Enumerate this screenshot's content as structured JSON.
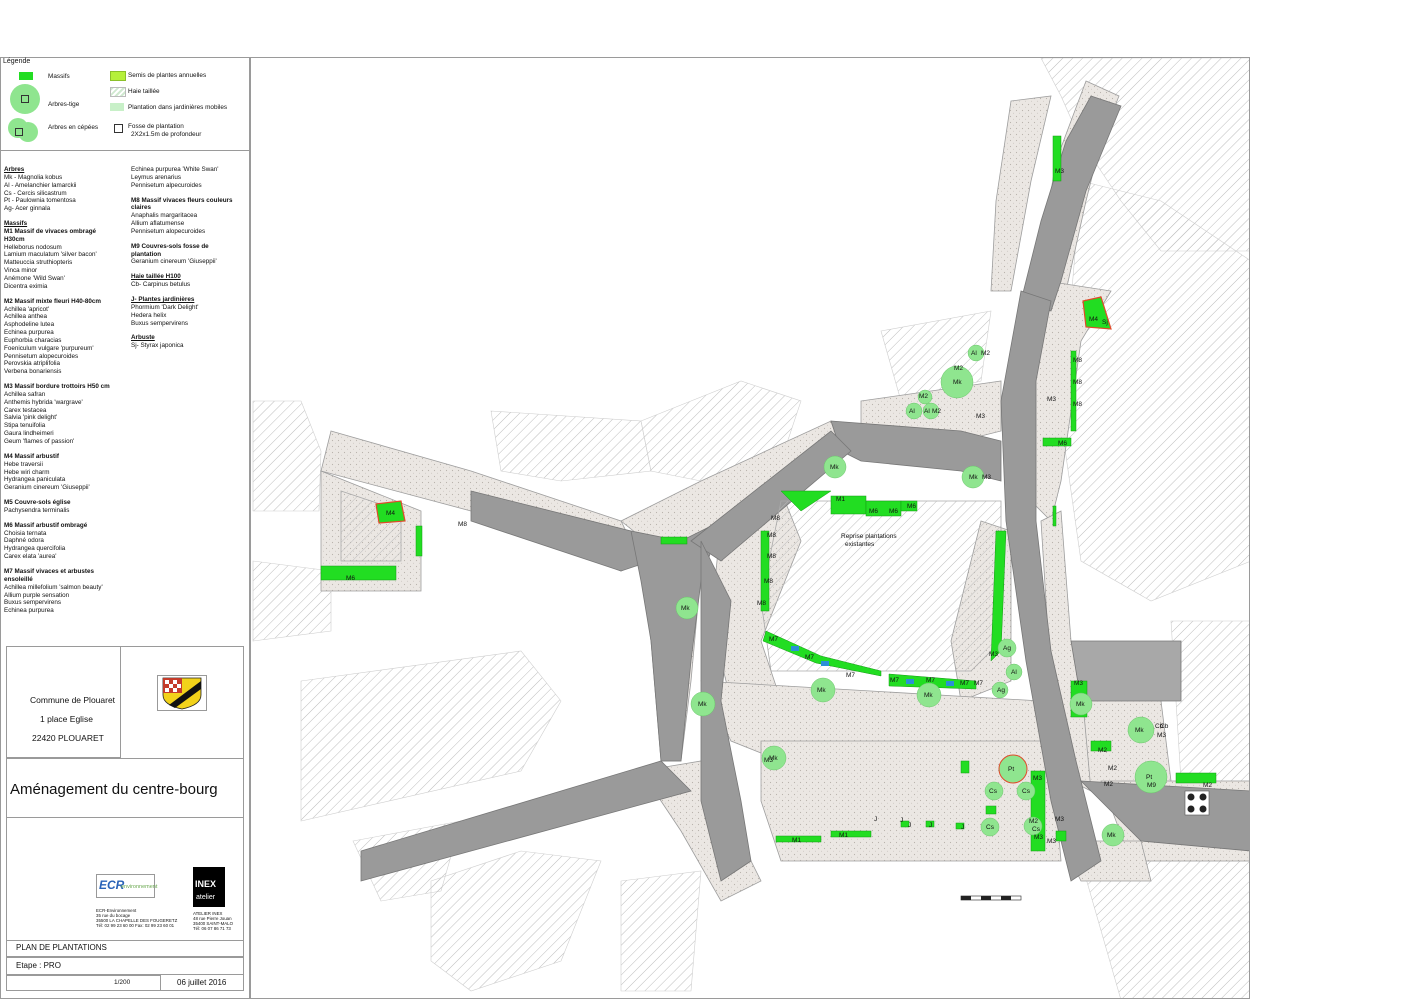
{
  "legend": {
    "title": "Légende",
    "items": [
      {
        "label": "Massifs",
        "color": "#22dd22"
      },
      {
        "label": "Arbres-tige",
        "color": "#8fe58f"
      },
      {
        "label": "Arbres en cépées",
        "color": "#8fe58f"
      },
      {
        "label": "Semis de plantes annuelles",
        "color": "#b5f03a"
      },
      {
        "label": "Haie taillée",
        "color": "#cfe8cf"
      },
      {
        "label": "Plantation dans jardinières mobiles",
        "color": "#c8f0c8"
      },
      {
        "label": "Fosse de plantation",
        "color": "#ffffff"
      }
    ],
    "fosse_sub": "2X2x1.5m de profondeur"
  },
  "plants_col1": [
    {
      "text": "Arbres",
      "style": "h-u"
    },
    {
      "text": "Mk - Magnolia kobus"
    },
    {
      "text": "Al - Amelanchier lamarckii"
    },
    {
      "text": "Cs - Cercis silicastrum"
    },
    {
      "text": "Pt - Paulownia tomentosa"
    },
    {
      "text": "Ag- Acer ginnala"
    },
    {
      "text": "",
      "style": "gap"
    },
    {
      "text": "Massifs",
      "style": "h-u"
    },
    {
      "text": "M1 Massif de  vivaces ombragé",
      "style": "h"
    },
    {
      "text": "H30cm",
      "style": "h"
    },
    {
      "text": "Helleborus nodosum"
    },
    {
      "text": "Lamium maculatum 'silver bacon'"
    },
    {
      "text": "Matteuccia struthiopteris"
    },
    {
      "text": "Vinca minor"
    },
    {
      "text": "Anémone 'Wild Swan'"
    },
    {
      "text": "Dicentra eximia"
    },
    {
      "text": "",
      "style": "gap"
    },
    {
      "text": "M2 Massif mixte fleuri H40-80cm",
      "style": "h"
    },
    {
      "text": "Achillea 'apricot'"
    },
    {
      "text": "Achillea anthea"
    },
    {
      "text": "Asphodeline lutea"
    },
    {
      "text": "Echinea purpurea"
    },
    {
      "text": "Euphorbia characias"
    },
    {
      "text": "Foeniculum vulgare 'purpureum'"
    },
    {
      "text": "Pennisetum alopecuroides"
    },
    {
      "text": "Perovskia atriplifolia"
    },
    {
      "text": "Verbena bonariensis"
    },
    {
      "text": "",
      "style": "gap"
    },
    {
      "text": "M3 Massif bordure trottoirs H50 cm",
      "style": "h"
    },
    {
      "text": "Achillea safran"
    },
    {
      "text": "Anthemis hybrida 'wargrave'"
    },
    {
      "text": "Carex testacea"
    },
    {
      "text": "Salvia 'pink delight'"
    },
    {
      "text": "Stipa tenuifolia"
    },
    {
      "text": "Gaura lindheimeri"
    },
    {
      "text": "Geum 'flames of passion'"
    },
    {
      "text": "",
      "style": "gap"
    },
    {
      "text": "M4 Massif arbustif",
      "style": "h"
    },
    {
      "text": "Hebe traversii"
    },
    {
      "text": "Hebe wiri charm"
    },
    {
      "text": "Hydrangea paniculata"
    },
    {
      "text": "Geranium cinereum 'Giuseppii'"
    },
    {
      "text": "",
      "style": "gap"
    },
    {
      "text": "M5 Couvre-sols église",
      "style": "h"
    },
    {
      "text": "Pachysendra terminalis"
    },
    {
      "text": "",
      "style": "gap"
    },
    {
      "text": "M6 Massif arbustif ombragé",
      "style": "h"
    },
    {
      "text": "Choisia ternata"
    },
    {
      "text": "Daphné odora"
    },
    {
      "text": "Hydrangea quercifolia"
    },
    {
      "text": "Carex elata 'aurea'"
    },
    {
      "text": "",
      "style": "gap"
    },
    {
      "text": "M7 Massif vivaces et arbustes",
      "style": "h"
    },
    {
      "text": "ensoleillé",
      "style": "h"
    },
    {
      "text": "Achillea millefolium 'salmon beauty'"
    },
    {
      "text": "Allium purple sensation"
    },
    {
      "text": "Buxus sempervirens"
    },
    {
      "text": "Echinea purpurea"
    }
  ],
  "plants_col2": [
    {
      "text": "Echinea purpurea 'White Swan'"
    },
    {
      "text": "Leymus arenarius"
    },
    {
      "text": "Pennisetum alpecuroides"
    },
    {
      "text": "",
      "style": "gap"
    },
    {
      "text": "M8 Massif vivaces fleurs couleurs",
      "style": "h"
    },
    {
      "text": "claires",
      "style": "h"
    },
    {
      "text": "Anaphalis margaritacea"
    },
    {
      "text": "Allium aflatumense"
    },
    {
      "text": "Pennisetum alopecuroides"
    },
    {
      "text": "",
      "style": "gap"
    },
    {
      "text": "M9 Couvres-sols fosse de",
      "style": "h"
    },
    {
      "text": "plantation",
      "style": "h"
    },
    {
      "text": "Geranium cinereum 'Giuseppii'"
    },
    {
      "text": "",
      "style": "gap"
    },
    {
      "text": "Haie taillée H100",
      "style": "h-u"
    },
    {
      "text": "Cb- Carpinus betulus"
    },
    {
      "text": "",
      "style": "gap"
    },
    {
      "text": "J- Plantes jardinières",
      "style": "h-u"
    },
    {
      "text": "Phormium 'Dark Delight'"
    },
    {
      "text": "Hedera helix"
    },
    {
      "text": "Buxus sempervirens"
    },
    {
      "text": "",
      "style": "gap"
    },
    {
      "text": "Arbuste",
      "style": "h-u"
    },
    {
      "text": "Sj- Styrax japonica"
    }
  ],
  "client": {
    "name": "Commune de Plouaret",
    "address": "1 place Eglise",
    "city": "22420 PLOUARET"
  },
  "project_title": "Aménagement du centre-bourg",
  "firms": {
    "ecr": {
      "logo_text": "ECR",
      "logo_sub": "environnement",
      "name": "ECR-Environnement",
      "address": "35 rue du bocage",
      "city": "35500 LA CHAPELLE DES FOUGERETZ",
      "tel": "Tél: 02 99 23 60 00    Fax: 02 99 23 60 01"
    },
    "inex": {
      "logo_top": "INEX",
      "logo_bottom": "atelier",
      "name": "ATELIER INEX",
      "address": "48 rue Pierre Jouan",
      "city": "35400 SAINT-MALO",
      "tel": "Tél: 06 07 86 71 73"
    }
  },
  "sheet": {
    "title": "PLAN DE PLANTATIONS",
    "stage": "Etape : PRO",
    "scale": "1/200",
    "date": "06 juillet 2016"
  },
  "map": {
    "note_line1": "Reprise plantations",
    "note_line2": "existantes",
    "colors": {
      "road": "#9a9a9a",
      "pavement": "#e6e2de",
      "massif": "#22dd22",
      "tree": "#8fe58f",
      "hatch": "#b8b8b8",
      "water": "#2b8fd6",
      "red": "#e04a2a"
    },
    "labels": [
      {
        "text": "M3"
      },
      {
        "text": "M4"
      },
      {
        "text": "Sj"
      },
      {
        "text": "M8"
      },
      {
        "text": "M8"
      },
      {
        "text": "M8"
      },
      {
        "text": "M6"
      },
      {
        "text": "Al"
      },
      {
        "text": "M2"
      },
      {
        "text": "M2"
      },
      {
        "text": "Mk"
      },
      {
        "text": "M2"
      },
      {
        "text": "Al"
      },
      {
        "text": "Al"
      },
      {
        "text": "M2"
      },
      {
        "text": "M3"
      },
      {
        "text": "Mk"
      },
      {
        "text": "Mk"
      },
      {
        "text": "M3"
      },
      {
        "text": "M1"
      },
      {
        "text": "M6"
      },
      {
        "text": "M6"
      },
      {
        "text": "M6"
      },
      {
        "text": "M4"
      },
      {
        "text": "M8"
      },
      {
        "text": "M6"
      },
      {
        "text": "M8"
      },
      {
        "text": "M8"
      },
      {
        "text": "M8"
      },
      {
        "text": "M8"
      },
      {
        "text": "M8"
      },
      {
        "text": "Mk"
      },
      {
        "text": "M7"
      },
      {
        "text": "M7"
      },
      {
        "text": "M7"
      },
      {
        "text": "M7"
      },
      {
        "text": "M7"
      },
      {
        "text": "M7"
      },
      {
        "text": "M7"
      },
      {
        "text": "Mk"
      },
      {
        "text": "Mk"
      },
      {
        "text": "Ag"
      },
      {
        "text": "M3"
      },
      {
        "text": "Al"
      },
      {
        "text": "Ag"
      },
      {
        "text": "Mk"
      },
      {
        "text": "M3"
      },
      {
        "text": "Mk"
      },
      {
        "text": "Cb"
      },
      {
        "text": "M3"
      },
      {
        "text": "M2"
      },
      {
        "text": "M2"
      },
      {
        "text": "Pt"
      },
      {
        "text": "M9"
      },
      {
        "text": "M2"
      },
      {
        "text": "Mk"
      },
      {
        "text": "M3"
      },
      {
        "text": "Pt"
      },
      {
        "text": "M3"
      },
      {
        "text": "Cs"
      },
      {
        "text": "Cs"
      },
      {
        "text": "M2"
      },
      {
        "text": "Cs"
      },
      {
        "text": "Cs"
      },
      {
        "text": "M3"
      },
      {
        "text": "Mk"
      },
      {
        "text": "M1"
      },
      {
        "text": "M1"
      },
      {
        "text": "J"
      },
      {
        "text": "J"
      },
      {
        "text": "J"
      },
      {
        "text": "J"
      },
      {
        "text": "M3"
      },
      {
        "text": "Mk"
      },
      {
        "text": "M3"
      },
      {
        "text": "M2"
      },
      {
        "text": "J"
      },
      {
        "text": "M3"
      },
      {
        "text": "Cb"
      }
    ]
  }
}
